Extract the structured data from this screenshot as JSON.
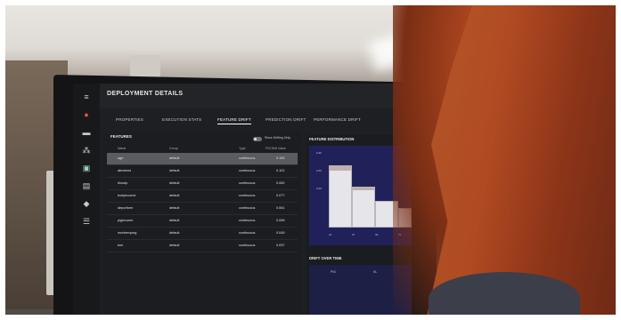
{
  "screen": {
    "title": "DEPLOYMENT DETAILS",
    "tabs": [
      {
        "label": "PROPERTIES"
      },
      {
        "label": "EXECUTION STATS"
      },
      {
        "label": "FEATURE DRIFT"
      },
      {
        "label": "PREDICTION DRIFT"
      },
      {
        "label": "PERFORMANCE DRIFT"
      }
    ],
    "features": {
      "title": "FEATURES",
      "toggle_label": "Show Drifting Only",
      "headers": [
        "Name",
        "Group",
        "Type",
        "PSI Drift Value"
      ],
      "rows": [
        {
          "name": "age",
          "group": "default",
          "type": "continuous",
          "value": "0.105"
        },
        {
          "name": "abndrest",
          "group": "default",
          "type": "continuous",
          "value": "0.101"
        },
        {
          "name": "bloodp",
          "group": "default",
          "type": "continuous",
          "value": "0.082"
        },
        {
          "name": "bodyincome",
          "group": "default",
          "type": "continuous",
          "value": "0.077"
        },
        {
          "name": "depurform",
          "group": "default",
          "type": "continuous",
          "value": "0.061"
        },
        {
          "name": "pigincome",
          "group": "default",
          "type": "continuous",
          "value": "0.056"
        },
        {
          "name": "numtemporg",
          "group": "default",
          "type": "continuous",
          "value": "0.049"
        },
        {
          "name": "bmi",
          "group": "default",
          "type": "continuous",
          "value": "0.037"
        }
      ]
    },
    "distribution": {
      "title": "FEATURE DISTRIBUTION",
      "y_ticks": [
        "0.30",
        "0.25",
        "0.20"
      ],
      "x_ticks": [
        "21",
        "27",
        "33",
        "39"
      ]
    },
    "drift_over_time": {
      "title": "DRIFT OVER TIME",
      "labels": [
        "PSI",
        "KL"
      ]
    }
  },
  "colors": {
    "screen_bg": "#1e1f22",
    "selected_row": "#5a5c60",
    "chart_bg": "#21215a"
  }
}
